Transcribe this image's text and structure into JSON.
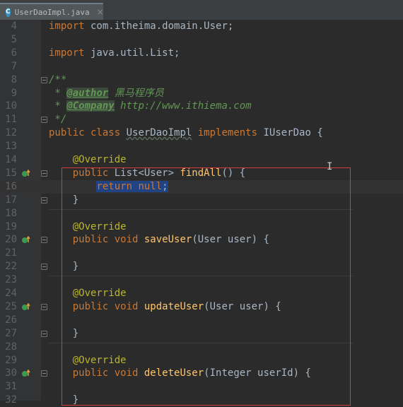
{
  "tab": {
    "icon": "C",
    "title": "UserDaoImpl.java",
    "close": "×"
  },
  "lines": [
    {
      "n": "4",
      "y": 0,
      "html": "<span class='kw'>import</span> com.itheima.domain.User;"
    },
    {
      "n": "5",
      "html": ""
    },
    {
      "n": "6",
      "html": "<span class='kw'>import</span> java.util.List;"
    },
    {
      "n": "7",
      "html": ""
    },
    {
      "n": "8",
      "html": "<span class='cm'>/**</span>"
    },
    {
      "n": "9",
      "html": "<span class='cm'> * </span><span class='tag tagbg'>@author</span><span class='cm'> 黑马程序员</span>"
    },
    {
      "n": "10",
      "html": "<span class='cm'> * </span><span class='tag tagbg'>@Company</span><span class='cm'> http://www.ithiema.com</span>"
    },
    {
      "n": "11",
      "html": "<span class='cm'> */</span>"
    },
    {
      "n": "12",
      "html": "<span class='kw'>public class</span> <span class='tn'>UserDaoImpl</span> <span class='kw'>implements</span> IUserDao {"
    },
    {
      "n": "13",
      "html": ""
    },
    {
      "n": "14",
      "html": "    <span class='ann'>@Override</span>"
    },
    {
      "n": "15",
      "html": "    <span class='kw'>public</span> List&lt;User&gt; <span class='fn'>findAll</span>() {"
    },
    {
      "n": "16",
      "html": "        <span class='sel'><span class='kw'>return null</span>;</span>"
    },
    {
      "n": "17",
      "html": "    }"
    },
    {
      "n": "18",
      "html": ""
    },
    {
      "n": "19",
      "html": "    <span class='ann'>@Override</span>"
    },
    {
      "n": "20",
      "html": "    <span class='kw'>public void</span> <span class='fn'>saveUser</span>(User user) {"
    },
    {
      "n": "21",
      "html": ""
    },
    {
      "n": "22",
      "html": "    }"
    },
    {
      "n": "23",
      "html": ""
    },
    {
      "n": "24",
      "html": "    <span class='ann'>@Override</span>"
    },
    {
      "n": "25",
      "html": "    <span class='kw'>public void</span> <span class='fn'>updateUser</span>(User user) {"
    },
    {
      "n": "26",
      "html": ""
    },
    {
      "n": "27",
      "html": "    }"
    },
    {
      "n": "28",
      "html": ""
    },
    {
      "n": "29",
      "html": "    <span class='ann'>@Override</span>"
    },
    {
      "n": "30",
      "html": "    <span class='kw'>public void</span> <span class='fn'>deleteUser</span>(Integer userId) {"
    },
    {
      "n": "31",
      "html": ""
    },
    {
      "n": "32",
      "html": "    }"
    }
  ],
  "override_lines": [
    "15",
    "20",
    "25",
    "30"
  ],
  "current_line": "16",
  "colors": {
    "highlight_box": "#d73a3a",
    "selection": "#214283",
    "keyword": "#cc7832"
  }
}
